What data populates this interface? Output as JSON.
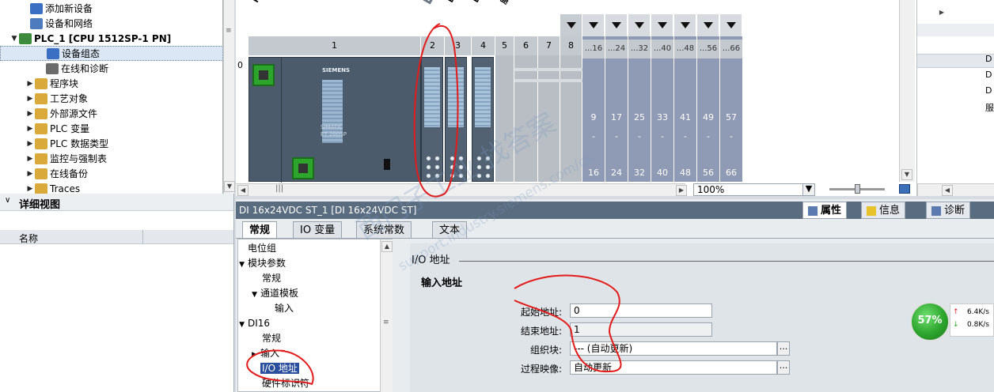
{
  "tree": {
    "items": [
      {
        "label": "添加新设备",
        "indent": 38,
        "arrow": "",
        "icon": "add-device-icon"
      },
      {
        "label": "设备和网络",
        "indent": 38,
        "arrow": "",
        "icon": "network-icon"
      },
      {
        "label": "PLC_1 [CPU 1512SP-1 PN]",
        "indent": 24,
        "arrow": "▼",
        "icon": "plc-icon",
        "bold": true
      },
      {
        "label": "设备组态",
        "indent": 58,
        "arrow": "",
        "icon": "device-config-icon",
        "selected": true
      },
      {
        "label": "在线和诊断",
        "indent": 58,
        "arrow": "",
        "icon": "online-diag-icon"
      },
      {
        "label": "程序块",
        "indent": 44,
        "arrow": "▶",
        "icon": "folder-icon"
      },
      {
        "label": "工艺对象",
        "indent": 44,
        "arrow": "▶",
        "icon": "folder-icon"
      },
      {
        "label": "外部源文件",
        "indent": 44,
        "arrow": "▶",
        "icon": "folder-icon"
      },
      {
        "label": "PLC 变量",
        "indent": 44,
        "arrow": "▶",
        "icon": "folder-icon"
      },
      {
        "label": "PLC 数据类型",
        "indent": 44,
        "arrow": "▶",
        "icon": "folder-icon"
      },
      {
        "label": "监控与强制表",
        "indent": 44,
        "arrow": "▶",
        "icon": "folder-icon"
      },
      {
        "label": "在线备份",
        "indent": 44,
        "arrow": "▶",
        "icon": "folder-icon"
      },
      {
        "label": "Traces",
        "indent": 44,
        "arrow": "▶",
        "icon": "folder-icon"
      }
    ]
  },
  "detail": {
    "title": "详细视图",
    "column": "名称"
  },
  "device": {
    "top_labels": [
      "PL",
      "DI",
      "DI",
      "DI",
      "服"
    ],
    "slots": [
      "1",
      "2",
      "3",
      "4",
      "5",
      "6",
      "7",
      "8"
    ],
    "big_heads": [
      "...16",
      "...24",
      "...32",
      "...40",
      "...48",
      "...56",
      "...66"
    ],
    "big_top": [
      "9",
      "17",
      "25",
      "33",
      "41",
      "49",
      "57"
    ],
    "big_bottom": [
      "16",
      "24",
      "32",
      "40",
      "48",
      "56",
      "66"
    ],
    "row_label": "0",
    "siemens": "SIEMENS",
    "simatic": "SIMATIC",
    "et": "ET 200SP",
    "zoom": "100%"
  },
  "rightpanel": {
    "items": [
      "D",
      "D",
      "D",
      "服"
    ]
  },
  "props": {
    "title": "DI 16x24VDC ST_1 [DI 16x24VDC ST]",
    "tabs": [
      "常规",
      "IO 变量",
      "系统常数",
      "文本"
    ],
    "right_tabs": [
      "属性",
      "信息",
      "诊断"
    ],
    "nav": [
      {
        "label": "电位组",
        "indent": 12,
        "arrow": ""
      },
      {
        "label": "模块参数",
        "indent": 12,
        "arrow": "▼"
      },
      {
        "label": "常规",
        "indent": 30,
        "arrow": ""
      },
      {
        "label": "通道模板",
        "indent": 28,
        "arrow": "▼"
      },
      {
        "label": "输入",
        "indent": 46,
        "arrow": ""
      },
      {
        "label": "DI16",
        "indent": 12,
        "arrow": "▼"
      },
      {
        "label": "常规",
        "indent": 30,
        "arrow": ""
      },
      {
        "label": "输入",
        "indent": 28,
        "arrow": "▶"
      },
      {
        "label": "I/O 地址",
        "indent": 28,
        "arrow": "",
        "selected": true
      },
      {
        "label": "硬件标识符",
        "indent": 30,
        "arrow": ""
      }
    ],
    "section": "I/O 地址",
    "subsection": "输入地址",
    "fields": [
      {
        "label": "起始地址:",
        "value": "0"
      },
      {
        "label": "结束地址:",
        "value": "1"
      },
      {
        "label": "组织块:",
        "value": "--- (自动更新)"
      },
      {
        "label": "过程映像:",
        "value": "自动更新"
      }
    ]
  },
  "net": {
    "percent": "57%",
    "up": "6.4K/s",
    "down": "0.8K/s"
  },
  "colors": {
    "accent": "#5a6c80",
    "selection": "#2a4f9e",
    "network_ok": "#2da52d"
  },
  "watermark": {
    "line1": "西门子工业 找答案",
    "line2": "support.industry.siemens.com/cs"
  }
}
